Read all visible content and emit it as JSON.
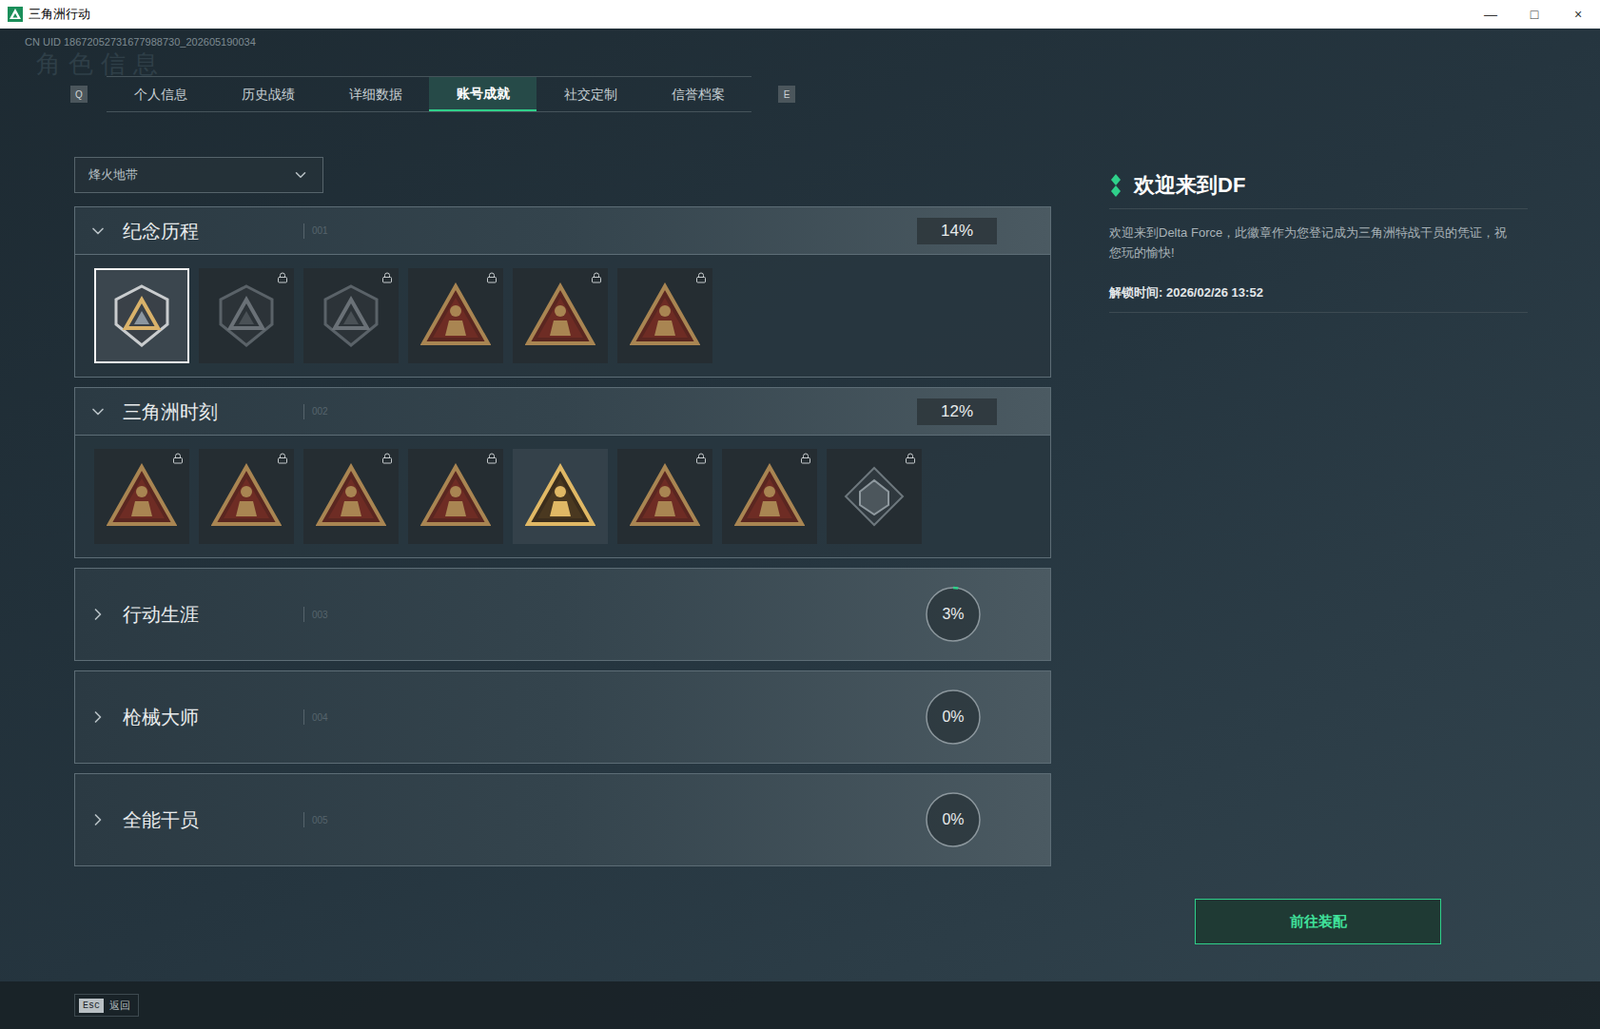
{
  "window": {
    "title": "三角洲行动",
    "controls": [
      "—",
      "□",
      "×"
    ]
  },
  "uid": "CN UID 18672052731677988730_202605190034",
  "watermark": "角色信息",
  "tabs": {
    "prev_key": "Q",
    "next_key": "E",
    "items": [
      {
        "label": "个人信息",
        "selected": false
      },
      {
        "label": "历史战绩",
        "selected": false
      },
      {
        "label": "详细数据",
        "selected": false
      },
      {
        "label": "账号成就",
        "selected": true
      },
      {
        "label": "社交定制",
        "selected": false
      },
      {
        "label": "信誉档案",
        "selected": false
      }
    ]
  },
  "mode_select": {
    "value": "烽火地带"
  },
  "sections": [
    {
      "title": "纪念历程",
      "index": "001",
      "expanded": true,
      "progress": "14%",
      "badges": [
        {
          "kind": "shield",
          "locked": false,
          "selected": true
        },
        {
          "kind": "shield",
          "locked": true,
          "selected": false
        },
        {
          "kind": "shield",
          "locked": true,
          "selected": false
        },
        {
          "kind": "triangle",
          "locked": true,
          "selected": false
        },
        {
          "kind": "triangle",
          "locked": true,
          "selected": false
        },
        {
          "kind": "triangle",
          "locked": true,
          "selected": false
        }
      ]
    },
    {
      "title": "三角洲时刻",
      "index": "002",
      "expanded": true,
      "progress": "12%",
      "badges": [
        {
          "kind": "triangle",
          "locked": true,
          "selected": false
        },
        {
          "kind": "triangle",
          "locked": true,
          "selected": false
        },
        {
          "kind": "triangle",
          "locked": true,
          "selected": false
        },
        {
          "kind": "triangle",
          "locked": true,
          "selected": false
        },
        {
          "kind": "triangle",
          "locked": false,
          "selected": false
        },
        {
          "kind": "triangle",
          "locked": true,
          "selected": false
        },
        {
          "kind": "triangle",
          "locked": true,
          "selected": false
        },
        {
          "kind": "diamond",
          "locked": true,
          "selected": false
        }
      ]
    },
    {
      "title": "行动生涯",
      "index": "003",
      "expanded": false,
      "progress": "3%",
      "level": 0.03,
      "badges": []
    },
    {
      "title": "枪械大师",
      "index": "004",
      "expanded": false,
      "progress": "0%",
      "level": 0,
      "badges": []
    },
    {
      "title": "全能干员",
      "index": "005",
      "expanded": false,
      "progress": "0%",
      "level": 0,
      "badges": []
    }
  ],
  "detail": {
    "title": "欢迎来到DF",
    "description": "欢迎来到Delta Force，此徽章作为您登记成为三角洲特战干员的凭证，祝您玩的愉快!",
    "unlock_time": "解锁时间: 2026/02/26 13:52"
  },
  "equip_button": "前往装配",
  "footer": {
    "key": "Esc",
    "label": "返回"
  }
}
